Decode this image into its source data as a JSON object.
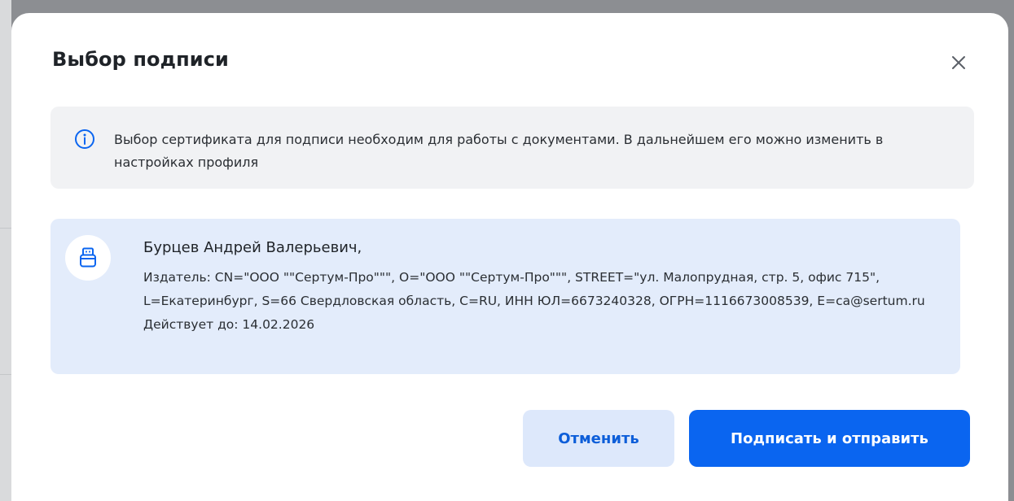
{
  "dialog": {
    "title": "Выбор подписи",
    "close_icon": "close-icon"
  },
  "info": {
    "icon": "info-icon",
    "text": "Выбор сертификата для подписи необходим для работы с документами. В дальнейшем его можно изменить в настройках профиля"
  },
  "certificate": {
    "icon": "usb-token-icon",
    "owner": "Бурцев Андрей Валерьевич,",
    "issuer": "Издатель: CN=\"ООО \"\"Сертум-Про\"\"\", O=\"ООО \"\"Сертум-Про\"\"\", STREET=\"ул. Малопрудная, стр. 5, офис 715\", L=Екатеринбург, S=66 Свердловская область, C=RU, ИНН ЮЛ=6673240328, ОГРН=1116673008539, E=ca@sertum.ru",
    "valid_until": "Действует до: 14.02.2026"
  },
  "actions": {
    "cancel_label": "Отменить",
    "submit_label": "Подписать и отправить"
  },
  "colors": {
    "primary": "#0a65f0",
    "card_selected": "#e3ecfb",
    "info_bg": "#f1f2f4"
  }
}
